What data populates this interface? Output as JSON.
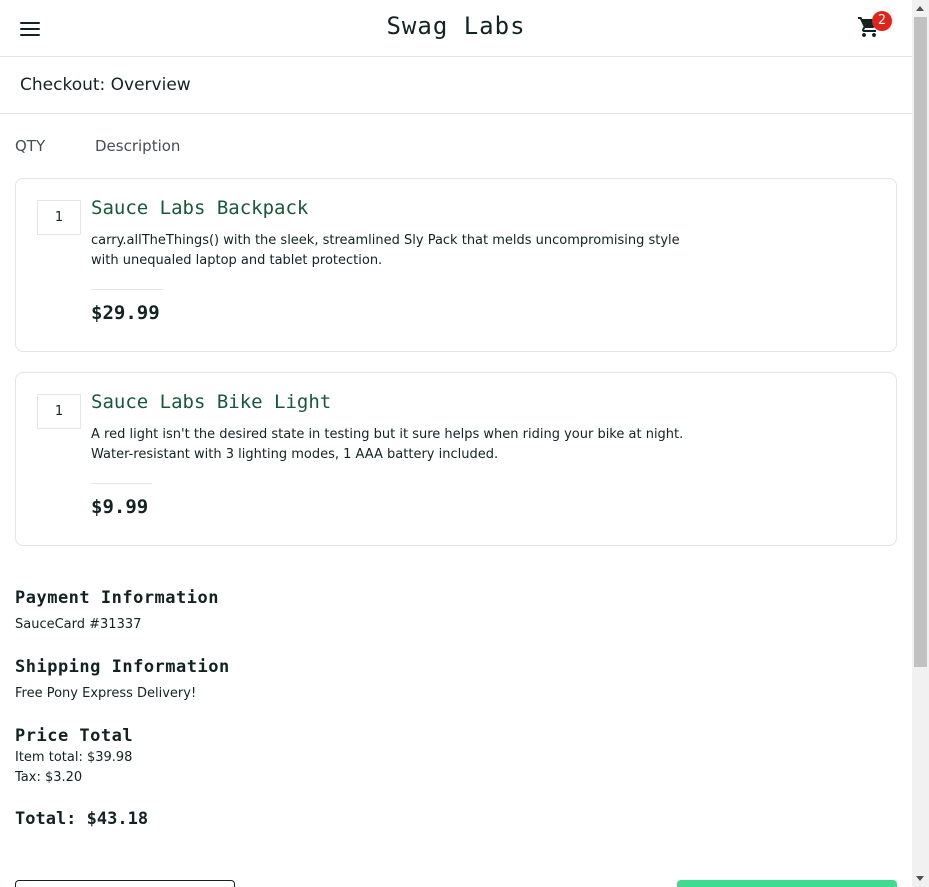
{
  "header": {
    "app_logo": "Swag Labs",
    "menu_icon": "hamburger-menu-icon",
    "cart_icon": "shopping-cart-icon",
    "cart_badge": "2"
  },
  "sub_header": {
    "title": "Checkout: Overview"
  },
  "columns": {
    "qty": "QTY",
    "description": "Description"
  },
  "items": [
    {
      "qty": "1",
      "name": "Sauce Labs Backpack",
      "description": "carry.allTheThings() with the sleek, streamlined Sly Pack that melds uncompromising style with unequaled laptop and tablet protection.",
      "price": "$29.99"
    },
    {
      "qty": "1",
      "name": "Sauce Labs Bike Light",
      "description": "A red light isn't the desired state in testing but it sure helps when riding your bike at night. Water-resistant with 3 lighting modes, 1 AAA battery included.",
      "price": "$9.99"
    }
  ],
  "summary": {
    "payment_label": "Payment Information",
    "payment_value": "SauceCard #31337",
    "shipping_label": "Shipping Information",
    "shipping_value": "Free Pony Express Delivery!",
    "price_label": "Price Total",
    "item_total": "Item total: $39.98",
    "tax": "Tax: $3.20",
    "total": "Total: $43.18"
  },
  "colors": {
    "accent_green": "#3ddc91",
    "item_name_green": "#18583a",
    "badge_red": "#e2231a"
  }
}
